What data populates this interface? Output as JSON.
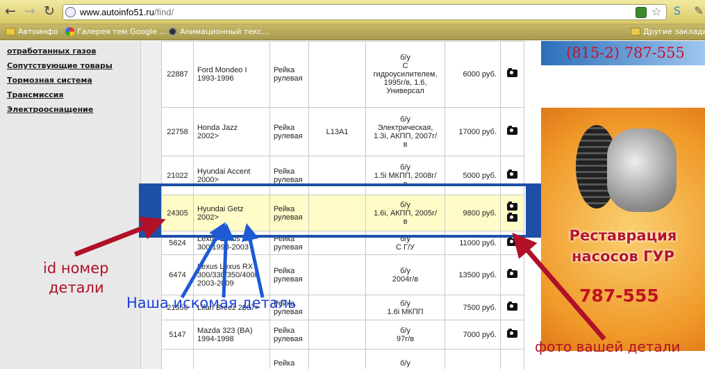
{
  "browser": {
    "url_host": "www.autoinfo51.ru",
    "url_path": "/find/",
    "bookmarks": [
      "Автоинфо",
      "Галерея тем Google ...",
      "Анимационный текс...",
      "Другие закладки"
    ]
  },
  "sidebar": {
    "items": [
      "отработанных газов",
      "Сопутствующие товары",
      "Тормозная система",
      "Трансмиссия",
      "Электрооснащение"
    ]
  },
  "table": {
    "rows": [
      {
        "id": "22887",
        "model": [
          "Ford Mondeo I",
          "1993-1996"
        ],
        "part": [
          "Рейка",
          "рулевая"
        ],
        "code": "",
        "desc": [
          "б/у",
          "С",
          "гидроусилителем,",
          "1995г/в, 1.6,",
          "Универсал"
        ],
        "price": "6000 руб.",
        "photos": 1
      },
      {
        "id": "22758",
        "model": [
          "Honda Jazz",
          "2002>"
        ],
        "part": [
          "Рейка",
          "рулевая"
        ],
        "code": "L13A1",
        "desc": [
          "б/у",
          "Электрическая,",
          "1.3i, АКПП, 2007г/",
          "в"
        ],
        "price": "17000 руб.",
        "photos": 1
      },
      {
        "id": "21022",
        "model": [
          "Hyundai Accent",
          "2000>"
        ],
        "part": [
          "Рейка",
          "рулевая"
        ],
        "code": "",
        "desc": [
          "б/у",
          "1.5i МКПП, 2008г/",
          "в"
        ],
        "price": "5000 руб.",
        "photos": 1
      },
      {
        "id": "24305",
        "model": [
          "Hyundai Getz",
          "2002>"
        ],
        "part": [
          "Рейка",
          "рулевая"
        ],
        "code": "",
        "desc": [
          "б/у",
          "1.6i, АКПП, 2005г/",
          "в"
        ],
        "price": "9800 руб.",
        "photos": 2,
        "highlight": true
      },
      {
        "id": "5624",
        "model": [
          "Lexus Lexus RX",
          "300 1998-2003"
        ],
        "part": [
          "Рейка",
          "рулевая"
        ],
        "code": "",
        "desc": [
          "б/у",
          "С Г/У"
        ],
        "price": "11000 руб.",
        "photos": 1
      },
      {
        "id": "6474",
        "model": [
          "Lexus Lexus RX",
          "300/330/350/400h",
          "2003-2009"
        ],
        "part": [
          "Рейка",
          "рулевая"
        ],
        "code": "",
        "desc": [
          "б/у",
          "2004г/в"
        ],
        "price": "13500 руб.",
        "photos": 1
      },
      {
        "id": "21356",
        "model": [
          "Lifan Breez 2007>"
        ],
        "part": [
          "Рейка",
          "рулевая"
        ],
        "code": "",
        "desc": [
          "б/у",
          "1.6i МКПП"
        ],
        "price": "7500 руб.",
        "photos": 1
      },
      {
        "id": "5147",
        "model": [
          "Mazda 323 (BA)",
          "1994-1998"
        ],
        "part": [
          "Рейка",
          "рулевая"
        ],
        "code": "",
        "desc": [
          "б/у",
          "97г/в"
        ],
        "price": "7000 руб.",
        "photos": 1
      },
      {
        "id": "",
        "model": [
          ""
        ],
        "part": [
          "Рейка"
        ],
        "code": "",
        "desc": [
          "б/у"
        ],
        "price": "",
        "photos": 0
      }
    ]
  },
  "ads": {
    "phone": "(815-2) 787-555",
    "headline": [
      "Реставрация",
      "насосов ГУР"
    ],
    "number": "787-555"
  },
  "annotations": {
    "id_label": [
      "id номер",
      "детали"
    ],
    "part_label": "Наша искомая деталь",
    "photo_label": "фото вашей детали"
  },
  "colors": {
    "annotation_red": "#b01028",
    "annotation_blue": "#1c3fd6",
    "frame_blue": "#1d4fa6",
    "row_highlight": "#fffcc8"
  }
}
